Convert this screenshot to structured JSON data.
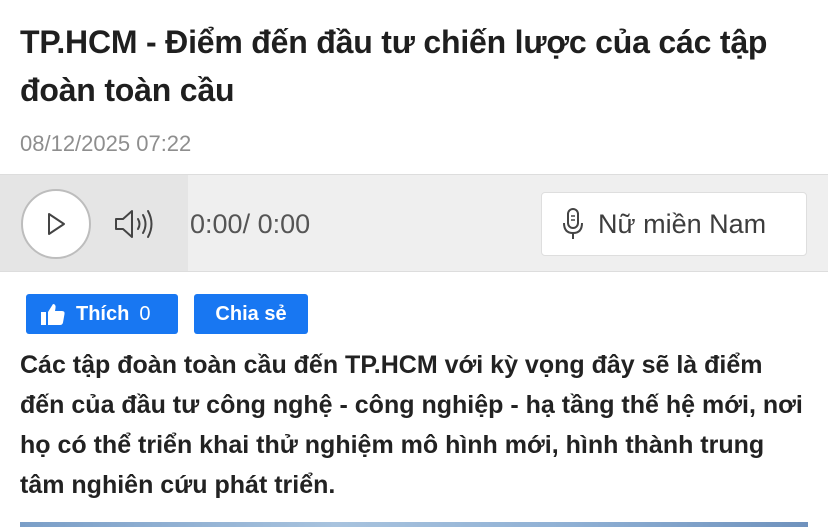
{
  "article": {
    "title": "TP.HCM - Điểm đến đầu tư chiến lược của các tập đoàn toàn cầu",
    "date": "08/12/2025 07:22",
    "summary": "Các tập đoàn toàn cầu đến TP.HCM với kỳ vọng đây sẽ là điểm đến của đầu tư công nghệ - công nghiệp - hạ tầng thế hệ mới, nơi họ có thể triển khai thử nghiệm mô hình mới, hình thành trung tâm nghiên cứu phát triển."
  },
  "player": {
    "current_time": "0:00",
    "separator": "/",
    "duration": "0:00",
    "voice_label": "Nữ miền Nam",
    "icons": {
      "play": "play-icon",
      "volume": "volume-icon",
      "voice": "microphone-icon"
    }
  },
  "social": {
    "like_label": "Thích",
    "like_count": "0",
    "share_label": "Chia sẻ",
    "brand_color": "#1877f2",
    "icons": {
      "like": "thumbs-up-icon"
    }
  }
}
